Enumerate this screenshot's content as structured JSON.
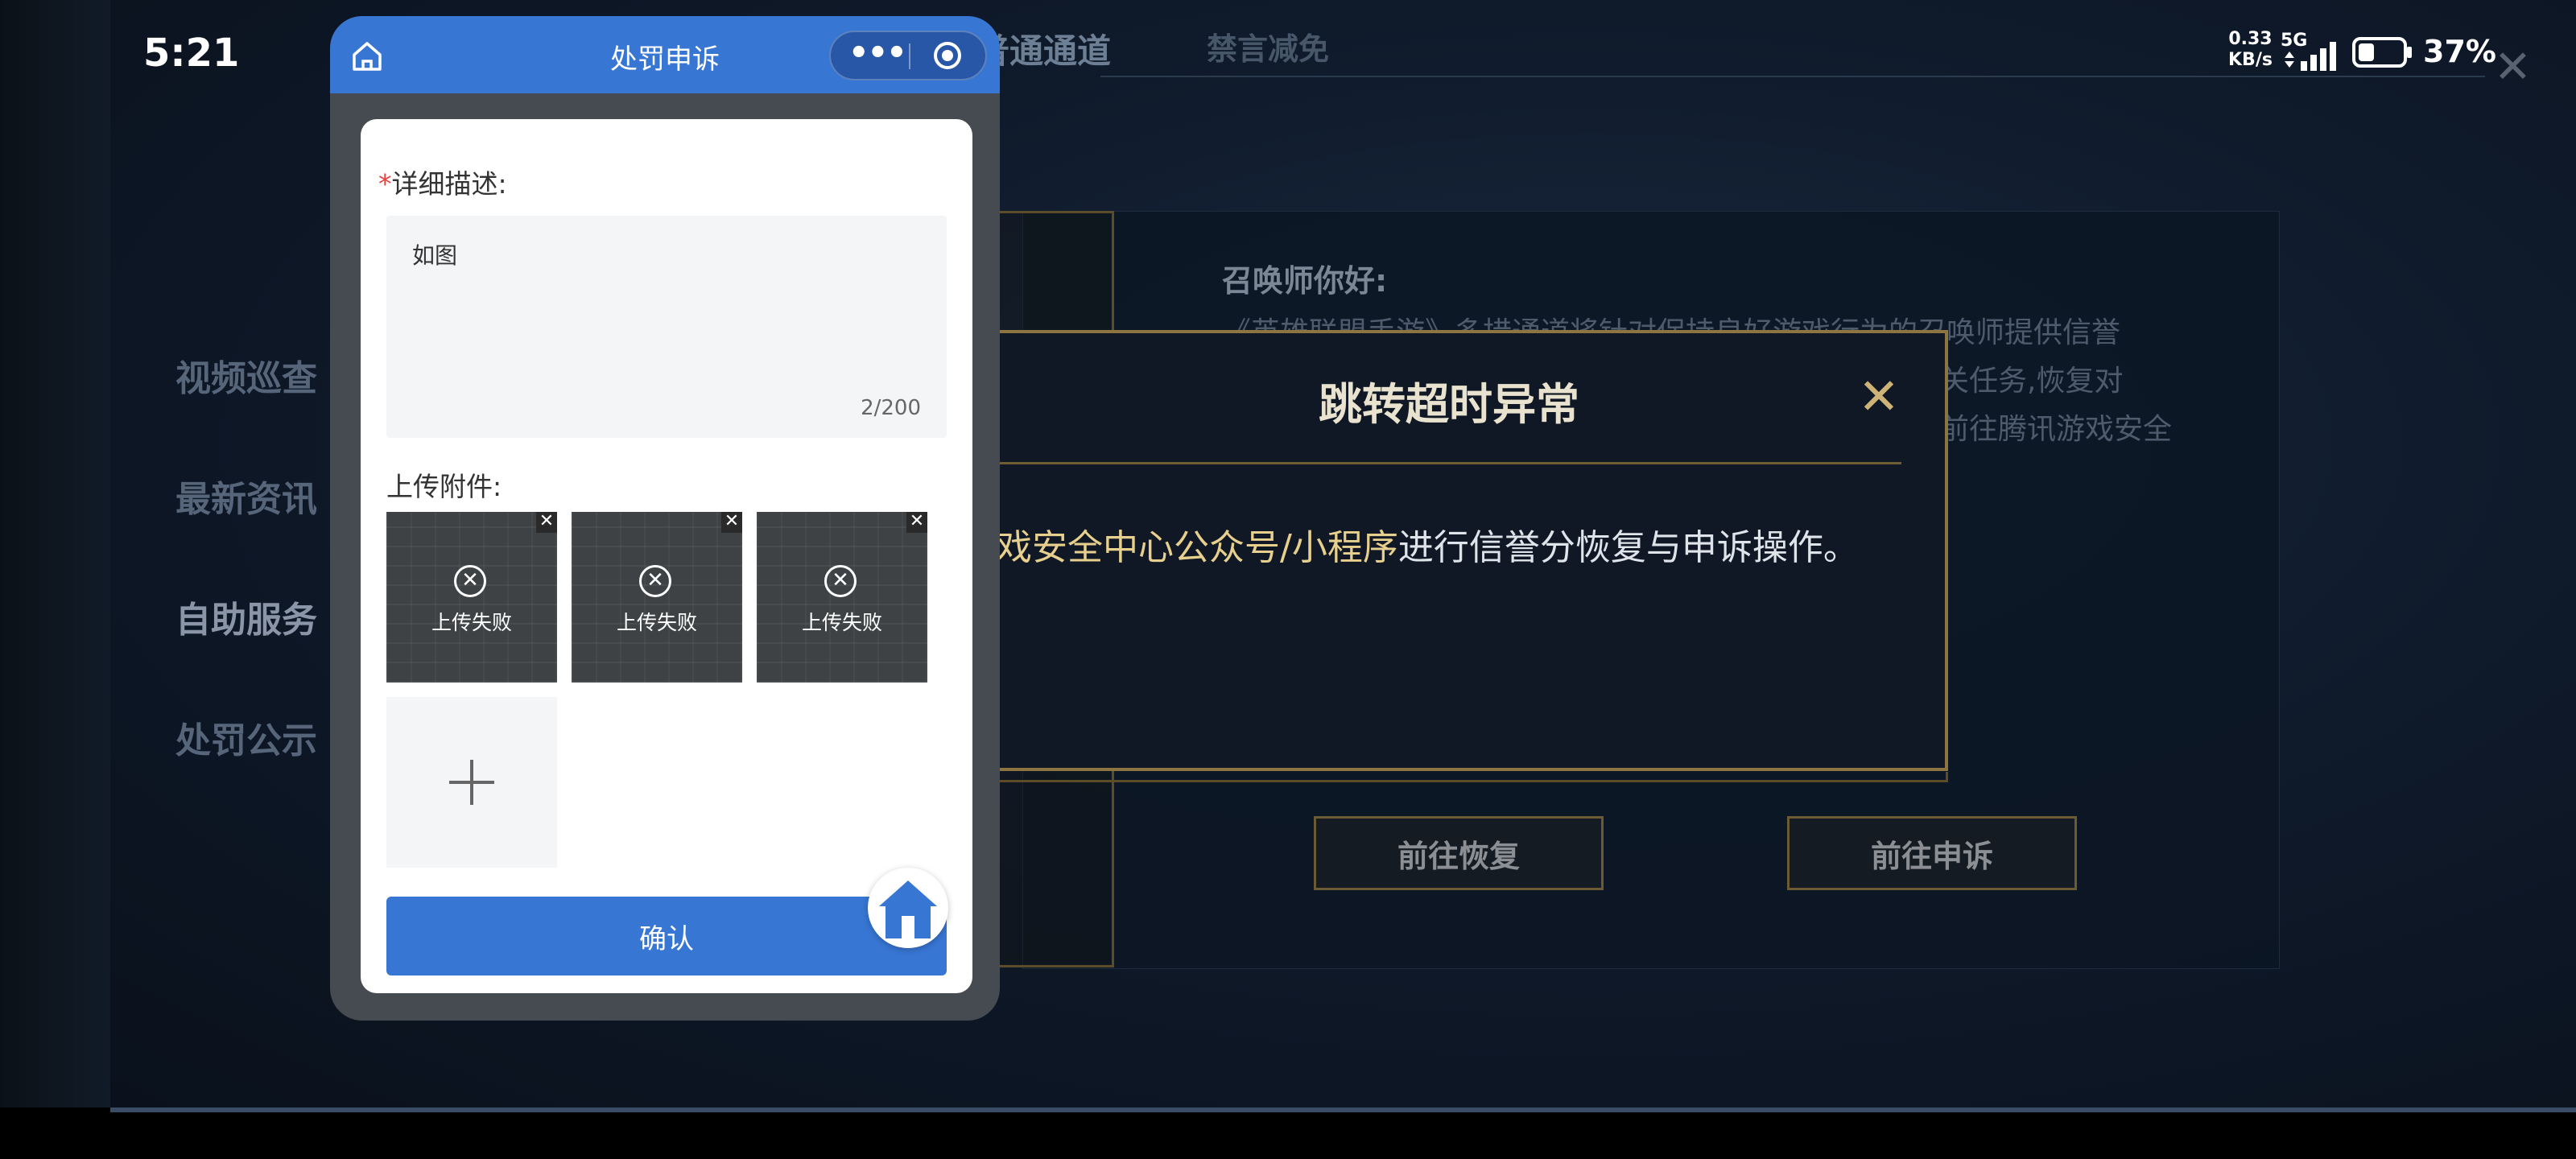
{
  "status_bar": {
    "time": "5:21",
    "net_speed_value": "0.33",
    "net_speed_unit": "KB/s",
    "network_type": "5G",
    "battery_percent": "37%",
    "battery_level": 0.37
  },
  "game": {
    "top_tabs": [
      "普通通道",
      "禁言减免"
    ],
    "sidebar": [
      "视频巡查",
      "最新资讯",
      "自助服务",
      "处罚公示"
    ],
    "greeting_title": "召唤师你好:",
    "greeting_lines": [
      "《英雄联盟手游》多措通道将针对保持良好游戏行为的召唤师提供信誉",
      "关任务,恢复对",
      "前往腾讯游戏安全"
    ],
    "buttons": {
      "restore": "前往恢复",
      "appeal": "前往申诉"
    }
  },
  "dialog": {
    "title": "跳转超时异常",
    "message_highlight": "戏安全中心公众号/小程序",
    "message_rest": "进行信誉分恢复与申诉操作。",
    "close_glyph": "✕"
  },
  "mini_program": {
    "title": "处罚申诉",
    "description_label": "详细描述:",
    "required_mark": "*",
    "description_value": "如图",
    "description_count": "2/200",
    "attachment_label": "上传附件:",
    "attachments": [
      {
        "status": "上传失败"
      },
      {
        "status": "上传失败"
      },
      {
        "status": "上传失败"
      }
    ],
    "confirm_label": "确认",
    "colors": {
      "primary": "#3876d4",
      "required": "#e64340"
    }
  }
}
